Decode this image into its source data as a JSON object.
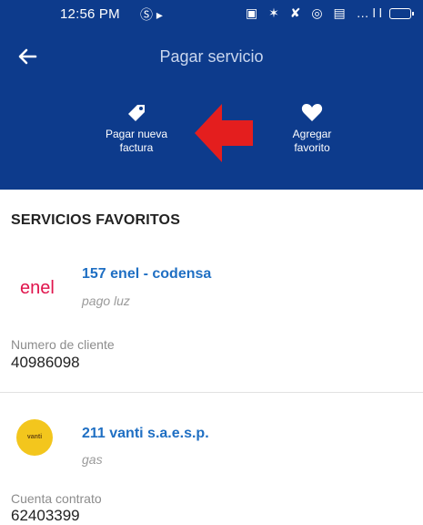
{
  "status_bar": {
    "time": "12:56 PM",
    "left_icons": "Ⓢ ▸",
    "right_icons": "▣ ✶ ✘ ◎ ▤ …ll"
  },
  "header": {
    "title": "Pagar servicio",
    "background_color": "#0d3b8c"
  },
  "actions": {
    "pay_new_bill": {
      "line1": "Pagar nueva",
      "line2": "factura",
      "icon": "tag-icon"
    },
    "add_favorite": {
      "line1": "Agregar",
      "line2": "favorito",
      "icon": "heart-icon"
    }
  },
  "section": {
    "title": "SERVICIOS FAVORITOS"
  },
  "favorites": [
    {
      "logo_text": "enel",
      "name": "157 enel - codensa",
      "type": "pago luz",
      "field_label": "Numero de cliente",
      "field_value": "40986098"
    },
    {
      "logo_text": "vanti",
      "name": "211 vanti s.a.e.s.p.",
      "type": "gas",
      "field_label": "Cuenta contrato",
      "field_value": "62403399"
    }
  ],
  "colors": {
    "accent_blue": "#1f6fc3",
    "pointer_red": "#e41e1e",
    "vanti_yellow": "#f3c61d"
  }
}
